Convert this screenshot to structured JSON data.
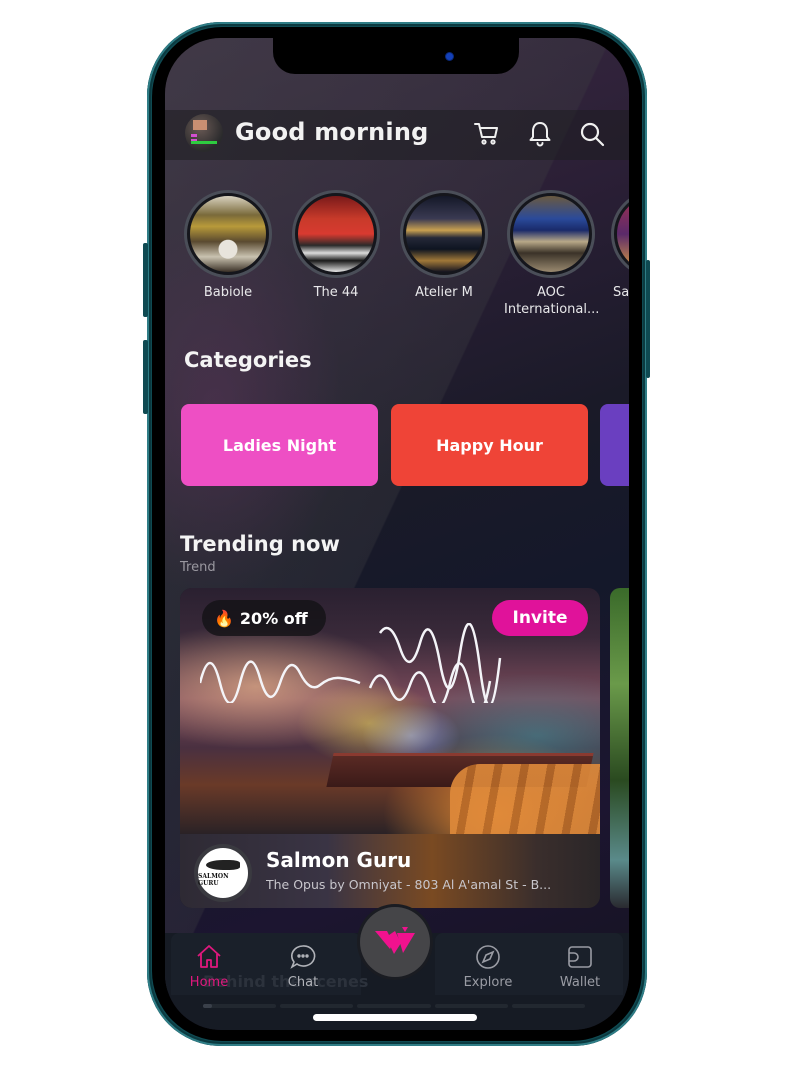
{
  "header": {
    "greeting": "Good morning",
    "icons": [
      "avatar",
      "cart-icon",
      "bell-icon",
      "search-icon"
    ]
  },
  "stories": [
    {
      "name": "Babiole"
    },
    {
      "name": "The 44"
    },
    {
      "name": "Atelier M"
    },
    {
      "name": "AOC International..."
    },
    {
      "name": "Sa"
    }
  ],
  "categories": {
    "title": "Categories",
    "items": [
      {
        "label": "Ladies Night",
        "color": "#ee4fc4"
      },
      {
        "label": "Happy Hour",
        "color": "#ef4437"
      },
      {
        "label": "",
        "color": "#6a3fc0"
      }
    ]
  },
  "trending": {
    "title": "Trending now",
    "subtitle": "Trend",
    "card": {
      "discount": "20% off",
      "discount_icon": "🔥",
      "invite_label": "Invite",
      "venue_name": "Salmon Guru",
      "venue_address": "The Opus by Omniyat - 803 Al A'amal St - B...",
      "logo_text": "SALMON GURU"
    }
  },
  "behind_scenes": {
    "title": "Behind the scenes",
    "progress_segments": 5,
    "first_segment_progress": 0.12
  },
  "nav": {
    "items": [
      {
        "label": "Home",
        "icon": "home-icon",
        "active": true
      },
      {
        "label": "Chat",
        "icon": "chat-icon",
        "active": false
      },
      {
        "label": "Explore",
        "icon": "compass-icon",
        "active": false
      },
      {
        "label": "Wallet",
        "icon": "wallet-icon",
        "active": false
      }
    ],
    "center_logo": "w-logo-icon"
  },
  "colors": {
    "accent": "#e0129a",
    "nav_active": "#e0187e"
  }
}
